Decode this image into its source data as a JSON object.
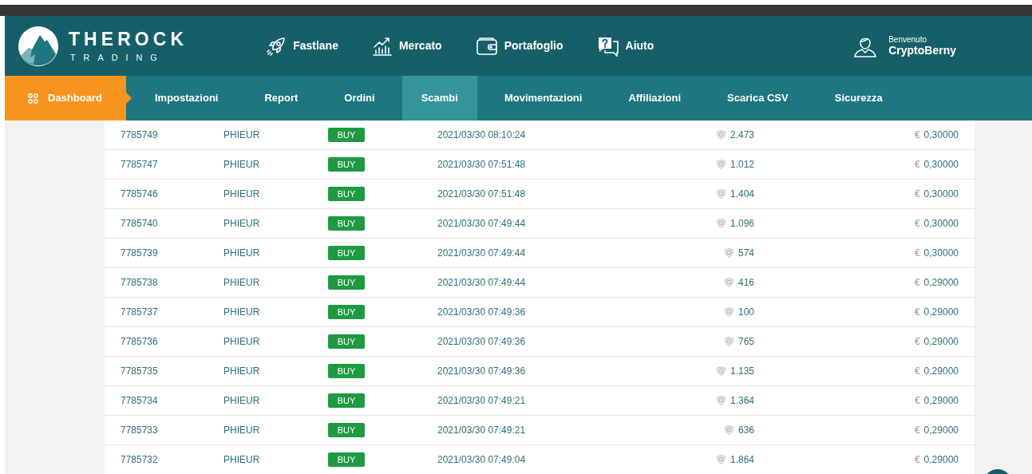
{
  "brand": {
    "name": "THEROCK",
    "tagline": "TRADING"
  },
  "top_menu": [
    {
      "label": "Fastlane",
      "kind": "rocket"
    },
    {
      "label": "Mercato",
      "kind": "chart"
    },
    {
      "label": "Portafoglio",
      "kind": "wallet"
    },
    {
      "label": "Aiuto",
      "kind": "help"
    }
  ],
  "user": {
    "greeting": "Benvenuto",
    "name": "CryptoBerny"
  },
  "dashboard": {
    "label": "Dashboard"
  },
  "tabs": [
    {
      "label": "Impostazioni",
      "selected": false
    },
    {
      "label": "Report",
      "selected": false
    },
    {
      "label": "Ordini",
      "selected": false
    },
    {
      "label": "Scambi",
      "selected": true
    },
    {
      "label": "Movimentazioni",
      "selected": false
    },
    {
      "label": "Affiliazioni",
      "selected": false
    },
    {
      "label": "Scarica CSV",
      "selected": false
    },
    {
      "label": "Sicurezza",
      "selected": false
    }
  ],
  "rows": [
    {
      "id": "7785749",
      "pair": "PHIEUR",
      "side": "BUY",
      "date": "2021/03/30 08:10:24",
      "amount": "2.473",
      "currency": "€",
      "price": "0,30000"
    },
    {
      "id": "7785747",
      "pair": "PHIEUR",
      "side": "BUY",
      "date": "2021/03/30 07:51:48",
      "amount": "1.012",
      "currency": "€",
      "price": "0,30000"
    },
    {
      "id": "7785746",
      "pair": "PHIEUR",
      "side": "BUY",
      "date": "2021/03/30 07:51:48",
      "amount": "1.404",
      "currency": "€",
      "price": "0,30000"
    },
    {
      "id": "7785740",
      "pair": "PHIEUR",
      "side": "BUY",
      "date": "2021/03/30 07:49:44",
      "amount": "1.096",
      "currency": "€",
      "price": "0,30000"
    },
    {
      "id": "7785739",
      "pair": "PHIEUR",
      "side": "BUY",
      "date": "2021/03/30 07:49:44",
      "amount": "574",
      "currency": "€",
      "price": "0,30000"
    },
    {
      "id": "7785738",
      "pair": "PHIEUR",
      "side": "BUY",
      "date": "2021/03/30 07:49:44",
      "amount": "416",
      "currency": "€",
      "price": "0,29000"
    },
    {
      "id": "7785737",
      "pair": "PHIEUR",
      "side": "BUY",
      "date": "2021/03/30 07:49:36",
      "amount": "100",
      "currency": "€",
      "price": "0,29000"
    },
    {
      "id": "7785736",
      "pair": "PHIEUR",
      "side": "BUY",
      "date": "2021/03/30 07:49:36",
      "amount": "765",
      "currency": "€",
      "price": "0,29000"
    },
    {
      "id": "7785735",
      "pair": "PHIEUR",
      "side": "BUY",
      "date": "2021/03/30 07:49:36",
      "amount": "1.135",
      "currency": "€",
      "price": "0,29000"
    },
    {
      "id": "7785734",
      "pair": "PHIEUR",
      "side": "BUY",
      "date": "2021/03/30 07:49:21",
      "amount": "1.364",
      "currency": "€",
      "price": "0,29000"
    },
    {
      "id": "7785733",
      "pair": "PHIEUR",
      "side": "BUY",
      "date": "2021/03/30 07:49:21",
      "amount": "636",
      "currency": "€",
      "price": "0,29000"
    },
    {
      "id": "7785732",
      "pair": "PHIEUR",
      "side": "BUY",
      "date": "2021/03/30 07:49:04",
      "amount": "1.864",
      "currency": "€",
      "price": "0,29000"
    }
  ]
}
